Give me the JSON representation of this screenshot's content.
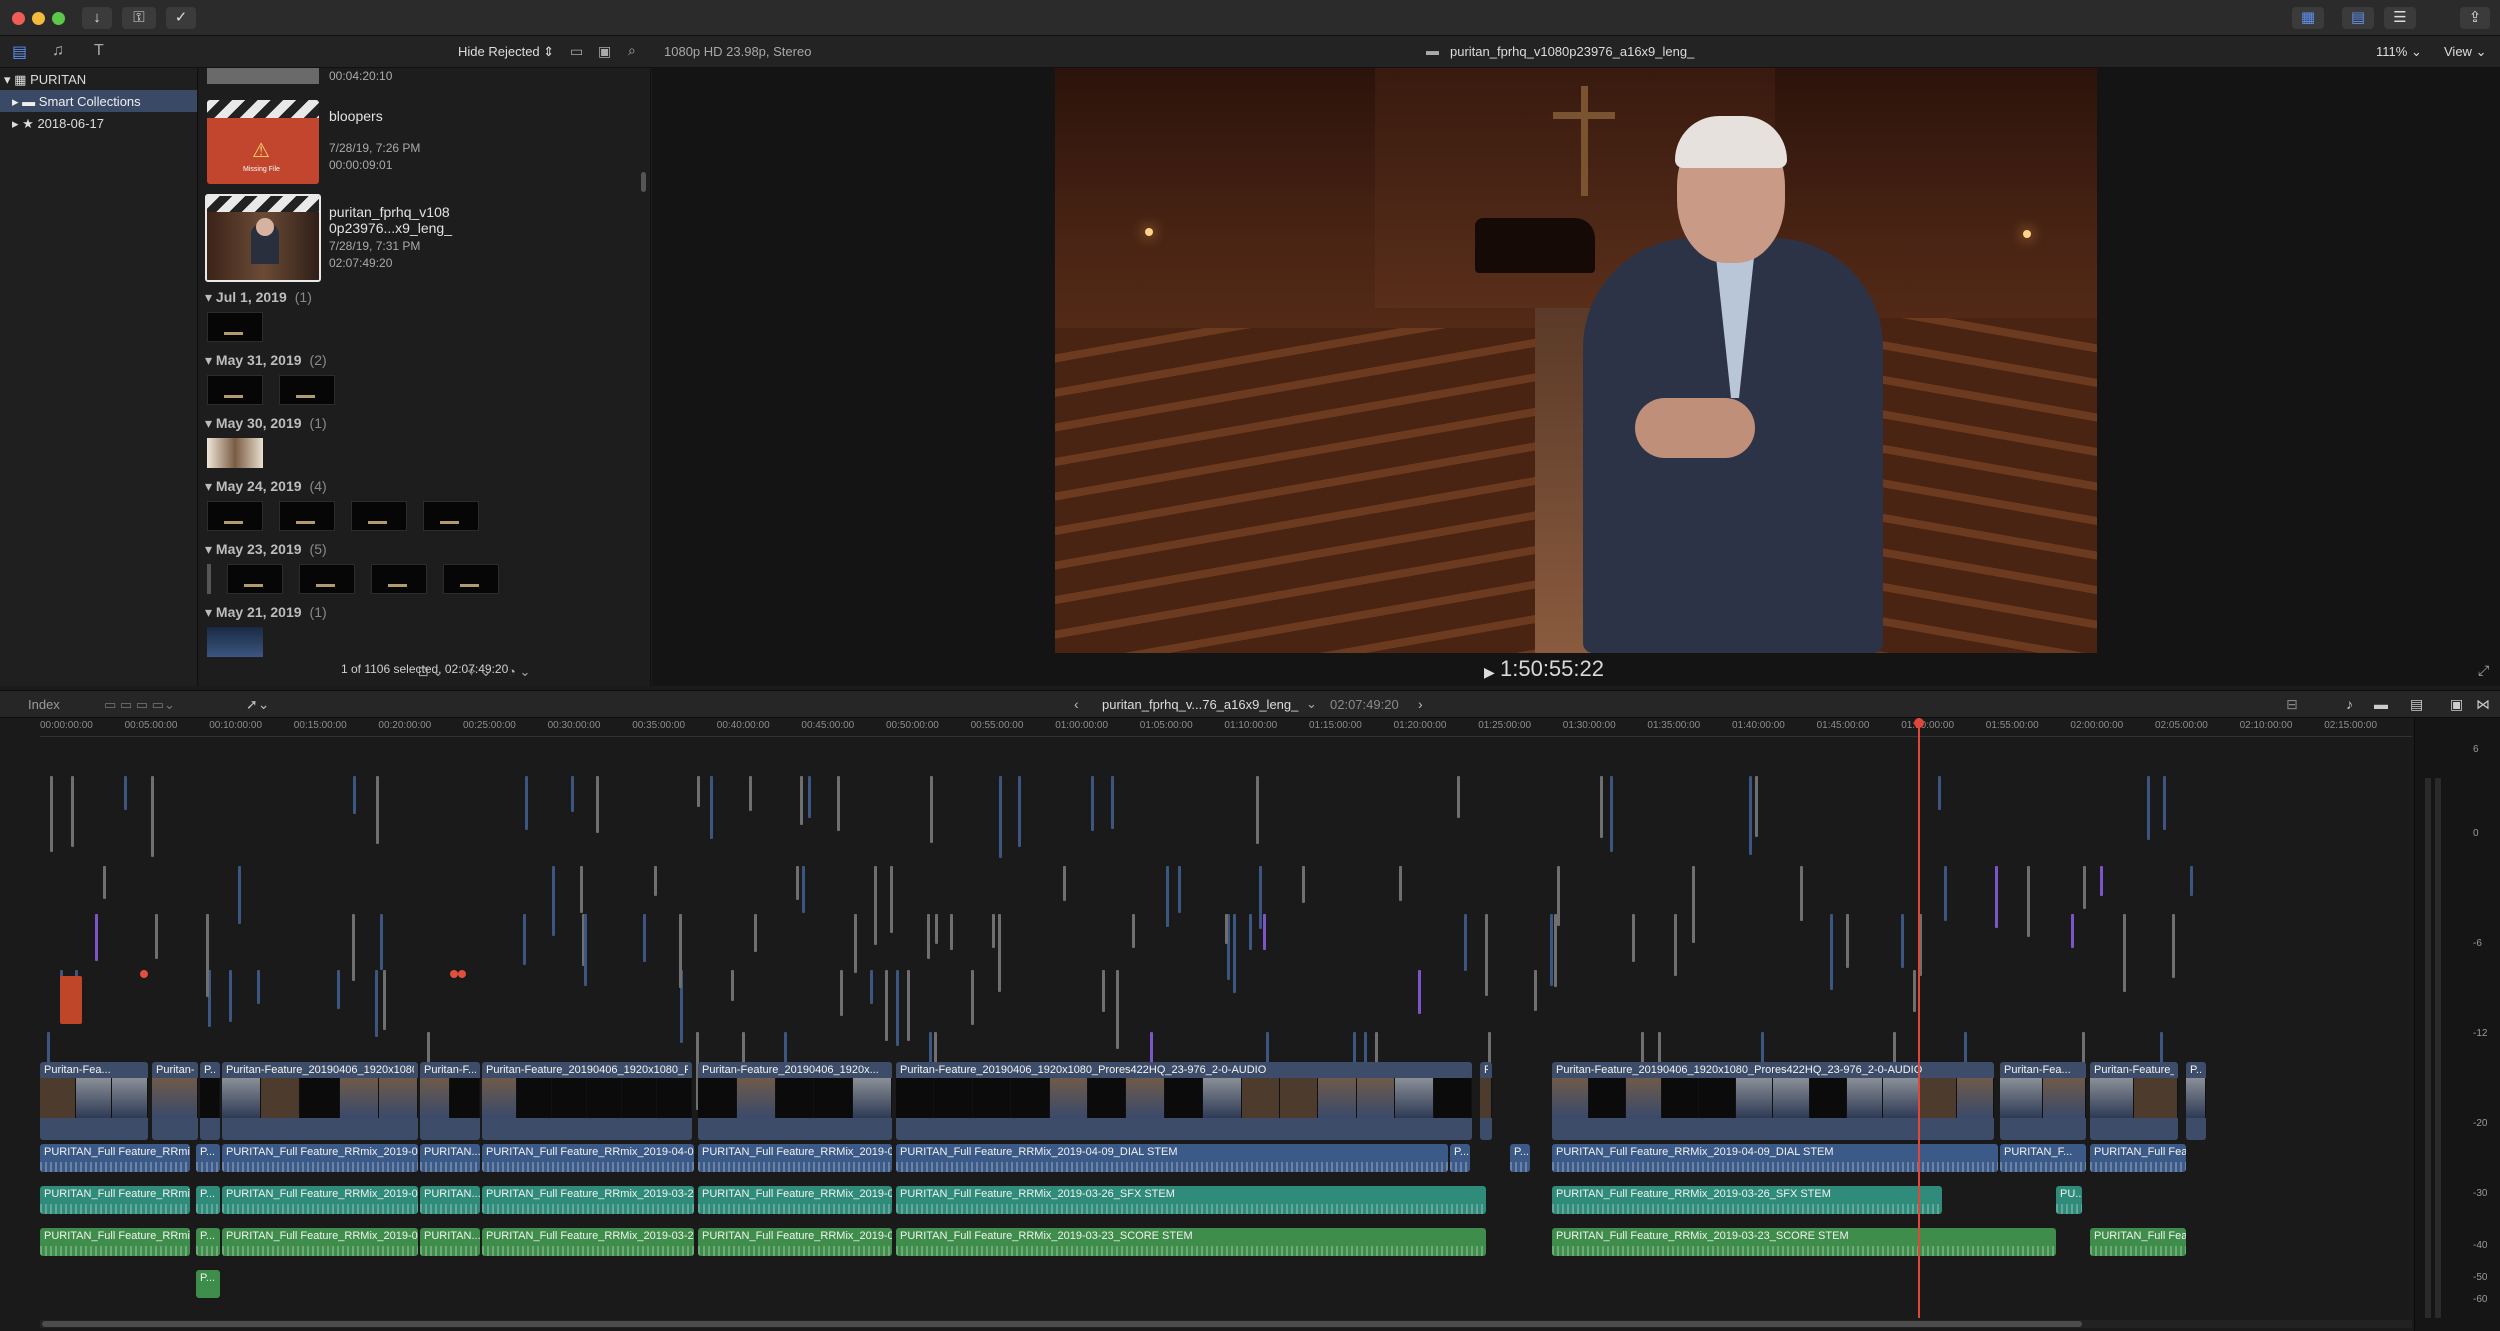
{
  "toolbar": {
    "hide_rejected": "Hide Rejected",
    "format": "1080p HD 23.98p, Stereo",
    "viewer_title": "puritan_fprhq_v1080p23976_a16x9_leng_",
    "zoom": "111%",
    "view": "View"
  },
  "sidebar": {
    "library": "PURITAN",
    "items": [
      "Smart Collections",
      "2018-06-17"
    ]
  },
  "browser": {
    "top_time": "00:04:20:10",
    "clips": [
      {
        "name": "bloopers",
        "date": "7/28/19, 7:26 PM",
        "duration": "00:00:09:01",
        "thumb_text": "Missing File"
      },
      {
        "name_line1": "puritan_fprhq_v108",
        "name_line2": "0p23976...x9_leng_",
        "date": "7/28/19, 7:31 PM",
        "duration": "02:07:49:20"
      }
    ],
    "groups": [
      {
        "date": "Jul 1, 2019",
        "count": "(1)"
      },
      {
        "date": "May 31, 2019",
        "count": "(2)"
      },
      {
        "date": "May 30, 2019",
        "count": "(1)"
      },
      {
        "date": "May 24, 2019",
        "count": "(4)"
      },
      {
        "date": "May 23, 2019",
        "count": "(5)"
      },
      {
        "date": "May 21, 2019",
        "count": "(1)"
      }
    ],
    "status": "1 of 1106 selected, 02:07:49:20"
  },
  "viewer": {
    "timecode": "1:50:55:22"
  },
  "timeline": {
    "index": "Index",
    "project": "puritan_fprhq_v...76_a16x9_leng_",
    "duration": "02:07:49:20",
    "ruler": [
      "00:00:00:00",
      "00:05:00:00",
      "00:10:00:00",
      "00:15:00:00",
      "00:20:00:00",
      "00:25:00:00",
      "00:30:00:00",
      "00:35:00:00",
      "00:40:00:00",
      "00:45:00:00",
      "00:50:00:00",
      "00:55:00:00",
      "01:00:00:00",
      "01:05:00:00",
      "01:10:00:00",
      "01:15:00:00",
      "01:20:00:00",
      "01:25:00:00",
      "01:30:00:00",
      "01:35:00:00",
      "01:40:00:00",
      "01:45:00:00",
      "01:50:00:00",
      "01:55:00:00",
      "02:00:00:00",
      "02:05:00:00",
      "02:10:00:00",
      "02:15:00:00"
    ],
    "video_clips": [
      "Puritan-Fea...",
      "Puritan-Feature",
      "P...",
      "Puritan-Feature_20190406_1920x1080...",
      "Puritan-F...",
      "Puritan-Feature_20190406_1920x1080_Pr...",
      "Puritan-Feature_20190406_1920x...",
      "Puritan-Feature_20190406_1920x1080_Prores422HQ_23-976_2-0-AUDIO",
      "P...",
      "Puritan-Feature_20190406_1920x1080_Prores422HQ_23-976_2-0-AUDIO",
      "Puritan-Fea...",
      "Puritan-Feature_...",
      "P..."
    ],
    "dial_clips": [
      "PURITAN_Full Feature_RRmix...",
      "P...",
      "PURITAN_Full Feature_RRmix_2019-04...",
      "PURITAN...",
      "PURITAN_Full Feature_RRmix_2019-04-09...",
      "PURITAN_Full Feature_RRMix_2019-04...",
      "PURITAN_Full Feature_RRMix_2019-04-09_DIAL STEM",
      "P...",
      "P...",
      "PURITAN_Full Feature_RRMix_2019-04-09_DIAL STEM",
      "PURITAN_F...",
      "PURITAN_Full Fea..."
    ],
    "sfx_clips": [
      "PURITAN_Full Feature_RRmix...",
      "P...",
      "PURITAN_Full Feature_RRMix_2019-03...",
      "PURITAN...",
      "PURITAN_Full Feature_RRmix_2019-03-26...",
      "PURITAN_Full Feature_RRMix_2019-03...",
      "PURITAN_Full Feature_RRMix_2019-03-26_SFX STEM",
      "PURITAN_Full Feature_RRMix_2019-03-26_SFX STEM",
      "PU..."
    ],
    "score_clips": [
      "PURITAN_Full Feature_RRmix...",
      "P...",
      "PURITAN_Full Feature_RRMix_2019-03...",
      "PURITAN...",
      "PURITAN_Full Feature_RRMix_2019-03-23...",
      "PURITAN_Full Feature_RRMix_2019-03...",
      "PURITAN_Full Feature_RRMix_2019-03-23_SCORE STEM",
      "PURITAN_Full Feature_RRMix_2019-03-23_SCORE STEM",
      "PURITAN_Full Fea..."
    ],
    "extra_clip": "P...",
    "meter_labels": [
      "6",
      "0",
      "-6",
      "-12",
      "-20",
      "-30",
      "-40",
      "-50",
      "-60"
    ]
  }
}
